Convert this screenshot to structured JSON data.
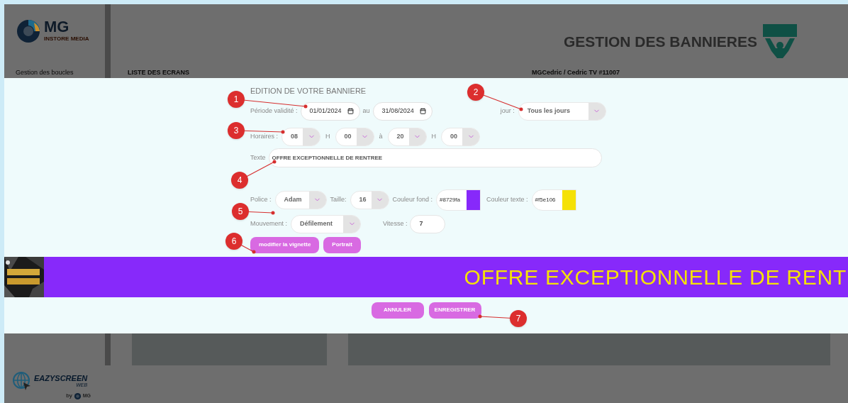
{
  "background": {
    "logo_text": "MG",
    "logo_subtitle": "INSTORE MEDIA",
    "sidebar_items": [
      "Gestion des boucles"
    ],
    "page_title": "GESTION DES BANNIERES",
    "section_label": "LISTE DES ECRANS",
    "user_label": "MGCedric / Cedric TV #11007",
    "footer_logo": {
      "name": "EAZYSCREEN",
      "sub": "WEB",
      "by": "by",
      "brand": "MG"
    }
  },
  "dialog": {
    "title": "EDITION DE VOTRE BANNIERE",
    "period": {
      "label": "Période validité :",
      "from": "01/01/2024",
      "separator": "au",
      "to": "31/08/2024"
    },
    "day": {
      "label": "jour :",
      "value": "Tous les jours"
    },
    "hours": {
      "label": "Horaires :",
      "start_hour": "08",
      "unit_1": "H",
      "start_minute": "00",
      "separator": "à",
      "end_hour": "20",
      "unit_2": "H",
      "end_minute": "00"
    },
    "text": {
      "label": "Texte",
      "value": "OFFRE EXCEPTIONNELLE DE RENTREE"
    },
    "font": {
      "label": "Police :",
      "value": "Adam"
    },
    "size": {
      "label": "Taille:",
      "value": "16"
    },
    "background_color": {
      "label": "Couleur fond :",
      "value": "#8729fa"
    },
    "text_color": {
      "label": "Couleur texte :",
      "value": "#f5e106"
    },
    "movement": {
      "label": "Mouvement :",
      "value": "Défilement"
    },
    "speed": {
      "label": "Vitesse :",
      "value": "7"
    },
    "thumbnail_buttons": [
      "modifier la vignette",
      "Portrait"
    ],
    "preview": {
      "text": "OFFRE EXCEPTIONNELLE DE RENT"
    },
    "actions": [
      "ANNULER",
      "ENREGISTRER"
    ]
  },
  "annotations": [
    "1",
    "2",
    "3",
    "4",
    "5",
    "6",
    "7"
  ]
}
